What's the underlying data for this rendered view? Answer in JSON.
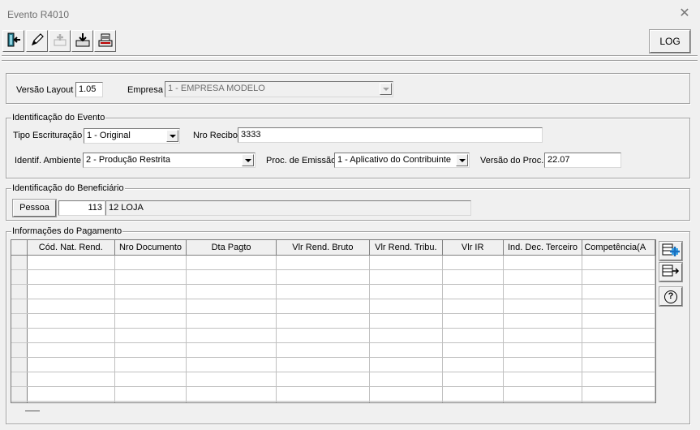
{
  "window": {
    "title": "Evento R4010",
    "close_glyph": "✕"
  },
  "toolbar": {
    "buttons": [
      {
        "name": "exit-icon"
      },
      {
        "name": "pencil-icon"
      },
      {
        "name": "add-disabled-icon"
      },
      {
        "name": "import-tray-icon"
      },
      {
        "name": "print-tray-icon"
      }
    ],
    "log_label": "LOG"
  },
  "header": {
    "versao_layout_label": "Versão Layout",
    "versao_layout_value": "1.05",
    "empresa_label": "Empresa",
    "empresa_value": "1 - EMPRESA MODELO"
  },
  "identificacao_evento": {
    "legend": "Identificação do Evento",
    "tipo_escrituracao_label": "Tipo Escrituração",
    "tipo_escrituracao_value": "1 - Original",
    "nro_recibo_label": "Nro Recibo",
    "nro_recibo_value": "3333",
    "identif_ambiente_label": "Identif. Ambiente",
    "identif_ambiente_value": "2 - Produção Restrita",
    "proc_emissao_label": "Proc. de Emissão",
    "proc_emissao_value": "1 - Aplicativo do Contribuinte",
    "versao_proc_label": "Versão do Proc.",
    "versao_proc_value": "22.07"
  },
  "identificacao_beneficiario": {
    "legend": "Identificação do Beneficiário",
    "pessoa_button": "Pessoa",
    "pessoa_code": "113",
    "pessoa_name": "12 LOJA"
  },
  "pagamento": {
    "legend": "Informações do Pagamento",
    "columns": [
      "Cód. Nat. Rend.",
      "Nro Documento",
      "Dta Pagto",
      "Vlr Rend. Bruto",
      "Vlr Rend. Tribu.",
      "Vlr IR",
      "Ind. Dec. Terceiro",
      "Competência(A"
    ],
    "row_count": 11
  },
  "side_buttons": [
    {
      "name": "add-row-icon"
    },
    {
      "name": "remove-row-icon"
    },
    {
      "name": "help-icon",
      "glyph": "?"
    }
  ]
}
